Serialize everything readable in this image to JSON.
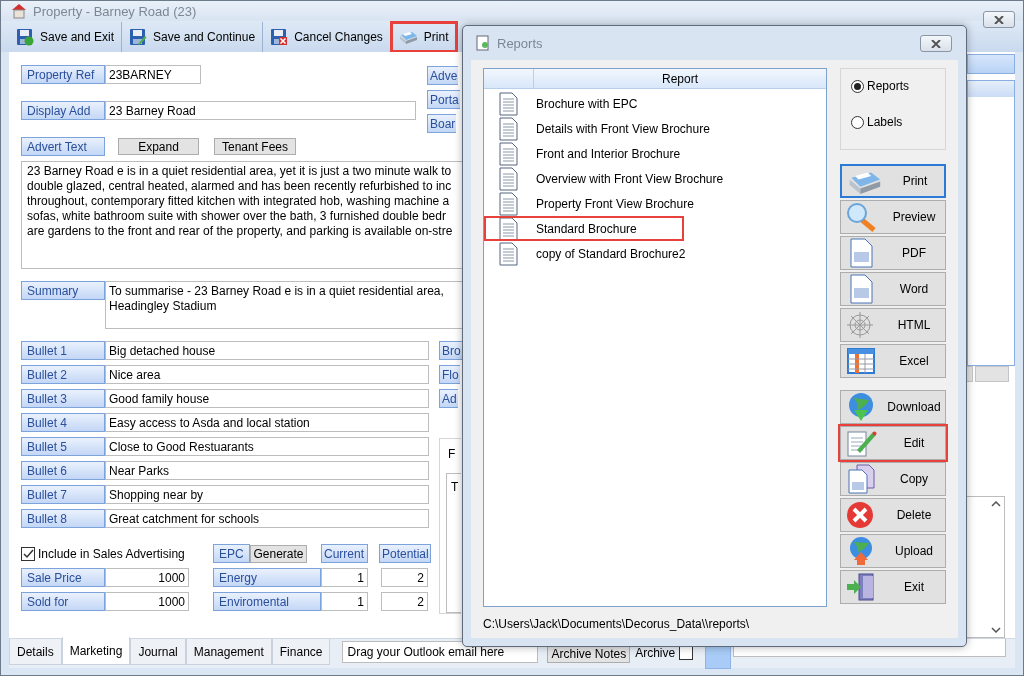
{
  "window": {
    "title": "Property  - Barney Road (23)"
  },
  "toolbar": [
    {
      "kind": "save_exit",
      "label": "Save and Exit",
      "highlighted": false
    },
    {
      "kind": "save_continue",
      "label": "Save and Continue",
      "highlighted": false
    },
    {
      "kind": "cancel",
      "label": "Cancel Changes",
      "highlighted": false
    },
    {
      "kind": "print",
      "label": "Print",
      "highlighted": true
    }
  ],
  "form": {
    "property_ref": {
      "label": "Property Ref",
      "value": "23BARNEY"
    },
    "display_address": {
      "label": "Display Add",
      "value": "23 Barney Road"
    },
    "side_buttons": [
      "Adve",
      "Porta",
      "Boar"
    ],
    "advert_text": {
      "label": "Advert Text",
      "buttons": [
        "Expand",
        "Tenant Fees"
      ],
      "lines": [
        "23 Barney Road e is in a quiet residential area, yet it is just a two minute walk to",
        "double glazed, central heated, alarmed and has been recently refurbished to inc",
        "throughout, contemporary fitted kitchen with integrated hob, washing machine a",
        "sofas, white bathroom suite with shower over the bath, 3 furnished double bedr",
        "are gardens to the front and rear of the property, and parking is available on-stre"
      ]
    },
    "summary": {
      "label": "Summary",
      "lines": [
        "To summarise - 23 Barney Road e is in a quiet residential area,",
        "Headingley Stadium"
      ]
    },
    "bullets": [
      {
        "label": "Bullet 1",
        "value": "Big detached house"
      },
      {
        "label": "Bullet 2",
        "value": "Nice area"
      },
      {
        "label": "Bullet 3",
        "value": "Good family house"
      },
      {
        "label": "Bullet 4",
        "value": "Easy access to Asda and local station"
      },
      {
        "label": "Bullet 5",
        "value": "Close to Good Restuarants"
      },
      {
        "label": "Bullet 6",
        "value": "Near Parks"
      },
      {
        "label": "Bullet 7",
        "value": "Shopping near by"
      },
      {
        "label": "Bullet 8",
        "value": "Great catchment for schools"
      }
    ],
    "side_buttons_2": [
      "Bro",
      "Flo",
      "Ad"
    ],
    "side_group": {
      "title": "F",
      "text": "T"
    },
    "advertising": {
      "label": "Include in  Sales Advertising",
      "checked": true
    },
    "prices": [
      {
        "label": "Sale Price",
        "value": "1000"
      },
      {
        "label": "Sold for",
        "value": "1000"
      }
    ],
    "epc": {
      "label": "EPC",
      "button": "Generate",
      "columns": [
        "Current",
        "Potential"
      ],
      "rows": [
        {
          "label": "Energy",
          "current": "1",
          "potential": "2"
        },
        {
          "label": "Enviromental",
          "current": "1",
          "potential": "2"
        }
      ]
    }
  },
  "tabs": [
    {
      "label": "Details",
      "selected": false
    },
    {
      "label": "Marketing",
      "selected": true
    },
    {
      "label": "Journal",
      "selected": false
    },
    {
      "label": "Management",
      "selected": false
    },
    {
      "label": "Finance",
      "selected": false
    }
  ],
  "outlook_drop": {
    "value": "Drag your Outlook email here"
  },
  "archive_notes": "Archive Notes",
  "archive": {
    "label": "Archive",
    "checked": false
  },
  "reports_dialog": {
    "title": "Reports",
    "column": "Report",
    "reports": [
      {
        "name": "Brochure with EPC",
        "highlighted": false
      },
      {
        "name": "Details with Front View Brochure",
        "highlighted": false
      },
      {
        "name": "Front and Interior Brochure",
        "highlighted": false
      },
      {
        "name": "Overview with Front View Brochure",
        "highlighted": false
      },
      {
        "name": "Property Front View Brochure",
        "highlighted": false
      },
      {
        "name": "Standard Brochure",
        "highlighted": true
      },
      {
        "name": "copy of Standard Brochure2",
        "highlighted": false
      }
    ],
    "modes": [
      {
        "label": "Reports",
        "selected": true
      },
      {
        "label": "Labels",
        "selected": false
      }
    ],
    "export_buttons": [
      {
        "kind": "print",
        "label": "Print",
        "focused": true,
        "highlighted": false
      },
      {
        "kind": "preview",
        "label": "Preview",
        "focused": false,
        "highlighted": false
      },
      {
        "kind": "pdf",
        "label": "PDF",
        "focused": false,
        "highlighted": false
      },
      {
        "kind": "word",
        "label": "Word",
        "focused": false,
        "highlighted": false
      },
      {
        "kind": "html",
        "label": "HTML",
        "focused": false,
        "highlighted": false
      },
      {
        "kind": "excel",
        "label": "Excel",
        "focused": false,
        "highlighted": false
      }
    ],
    "action_buttons": [
      {
        "kind": "download",
        "label": "Download",
        "focused": false,
        "highlighted": false
      },
      {
        "kind": "edit",
        "label": "Edit",
        "focused": false,
        "highlighted": true
      },
      {
        "kind": "copy",
        "label": "Copy",
        "focused": false,
        "highlighted": false
      },
      {
        "kind": "delete",
        "label": "Delete",
        "focused": false,
        "highlighted": false
      },
      {
        "kind": "upload",
        "label": "Upload",
        "focused": false,
        "highlighted": false
      },
      {
        "kind": "exit",
        "label": "Exit",
        "focused": false,
        "highlighted": false
      }
    ],
    "path": "C:\\Users\\Jack\\Documents\\Decorus_Data\\\\reports\\"
  }
}
